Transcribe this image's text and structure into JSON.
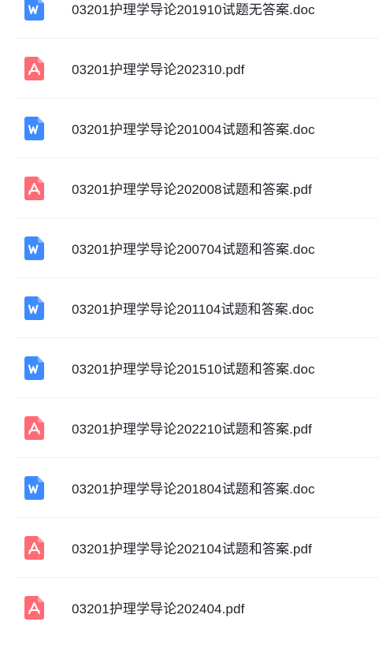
{
  "files": [
    {
      "name": "03201护理学导论201910试题无答案.doc",
      "type": "doc",
      "icon": "word-doc-icon"
    },
    {
      "name": "03201护理学导论202310.pdf",
      "type": "pdf",
      "icon": "pdf-icon"
    },
    {
      "name": "03201护理学导论201004试题和答案.doc",
      "type": "doc",
      "icon": "word-doc-icon"
    },
    {
      "name": "03201护理学导论202008试题和答案.pdf",
      "type": "pdf",
      "icon": "pdf-icon"
    },
    {
      "name": "03201护理学导论200704试题和答案.doc",
      "type": "doc",
      "icon": "word-doc-icon"
    },
    {
      "name": "03201护理学导论201104试题和答案.doc",
      "type": "doc",
      "icon": "word-doc-icon"
    },
    {
      "name": "03201护理学导论201510试题和答案.doc",
      "type": "doc",
      "icon": "word-doc-icon"
    },
    {
      "name": "03201护理学导论202210试题和答案.pdf",
      "type": "pdf",
      "icon": "pdf-icon"
    },
    {
      "name": "03201护理学导论201804试题和答案.doc",
      "type": "doc",
      "icon": "word-doc-icon"
    },
    {
      "name": "03201护理学导论202104试题和答案.pdf",
      "type": "pdf",
      "icon": "pdf-icon"
    },
    {
      "name": "03201护理学导论202404.pdf",
      "type": "pdf",
      "icon": "pdf-icon"
    }
  ],
  "colors": {
    "doc": "#3d8bff",
    "pdf": "#ff6b75",
    "text": "#1f2329",
    "divider": "#eef0f3"
  }
}
